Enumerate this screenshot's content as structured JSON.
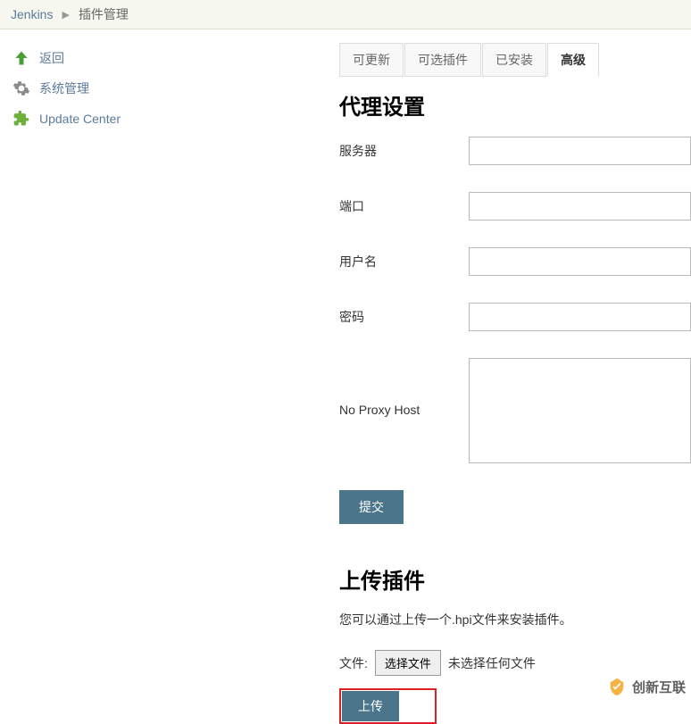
{
  "breadcrumb": {
    "root": "Jenkins",
    "current": "插件管理"
  },
  "sidebar": {
    "items": [
      {
        "label": "返回"
      },
      {
        "label": "系统管理"
      },
      {
        "label": "Update Center"
      }
    ]
  },
  "tabs": [
    {
      "label": "可更新"
    },
    {
      "label": "可选插件"
    },
    {
      "label": "已安装"
    },
    {
      "label": "高级"
    }
  ],
  "proxy": {
    "heading": "代理设置",
    "server_label": "服务器",
    "port_label": "端口",
    "user_label": "用户名",
    "password_label": "密码",
    "noproxy_label": "No Proxy Host",
    "submit_label": "提交"
  },
  "upload": {
    "heading": "上传插件",
    "desc": "您可以通过上传一个.hpi文件来安装插件。",
    "file_label": "文件:",
    "choose_btn": "选择文件",
    "no_file": "未选择任何文件",
    "upload_btn": "上传"
  },
  "watermark": "创新互联"
}
